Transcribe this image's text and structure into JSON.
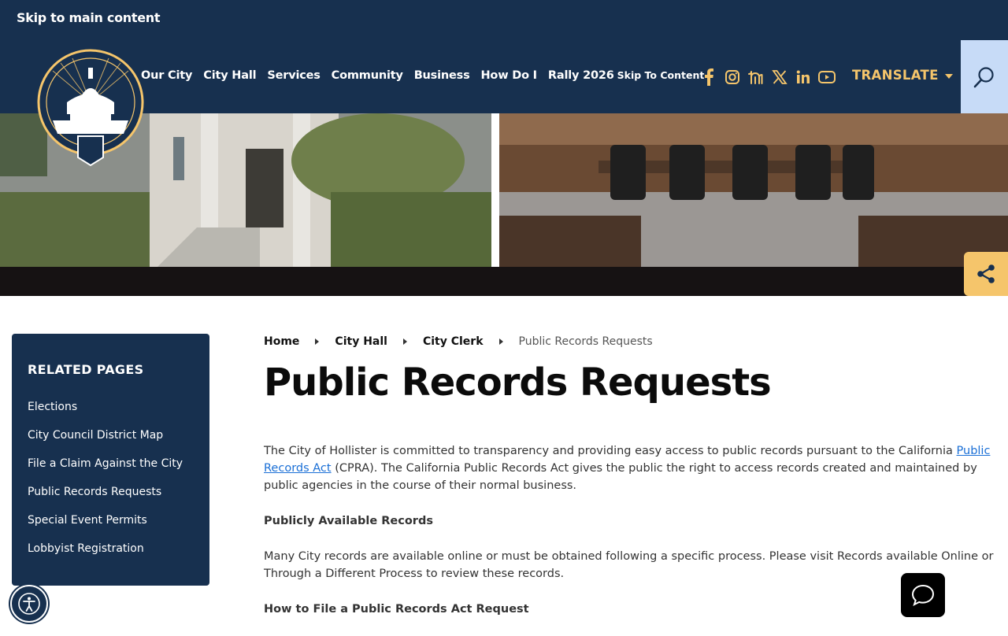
{
  "header": {
    "skip_link": "Skip to main content",
    "logo_alt": "The City of Hollister Est. 1872",
    "nav": [
      "Our City",
      "City Hall",
      "Services",
      "Community",
      "Business",
      "How Do I",
      "Rally 2026"
    ],
    "skip_to_content": "Skip To Content",
    "social_icons": [
      "facebook-icon",
      "instagram-icon",
      "nextdoor-icon",
      "x-icon",
      "linkedin-icon",
      "youtube-icon"
    ],
    "translate_label": "TRANSLATE"
  },
  "sidebar": {
    "title": "RELATED PAGES",
    "items": [
      "Elections",
      "City Council District Map",
      "File a Claim Against the City",
      "Public Records Requests",
      "Special Event Permits",
      "Lobbyist Registration"
    ]
  },
  "breadcrumb": {
    "items": [
      "Home",
      "City Hall",
      "City Clerk"
    ],
    "current": "Public Records Requests"
  },
  "page_title": "Public Records Requests",
  "content": {
    "intro_before_link": "The City of Hollister is committed to transparency and providing easy access to public records pursuant to the California ",
    "intro_link": "Public Records Act",
    "intro_after_link": " (CPRA). The California Public Records Act gives the public the right to access records created and maintained by public agencies in the course of their normal business.",
    "heading_1": "Publicly Available Records",
    "para_1": "Many City records are available online or must be obtained following a specific process. Please visit Records available Online or Through a Different Process to review these records.",
    "heading_2": "How to File a Public Records Act Request"
  },
  "colors": {
    "navy": "#17304f",
    "gold": "#f5c56b",
    "search_bg": "#c7dbf7",
    "link": "#1a6fd6"
  }
}
